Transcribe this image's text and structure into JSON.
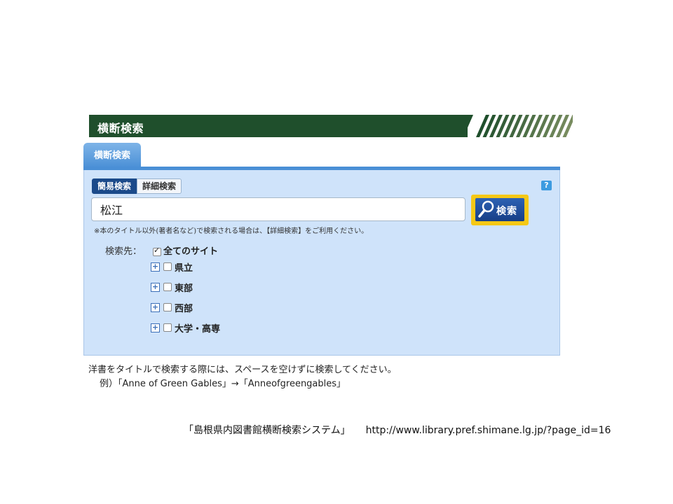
{
  "header": {
    "title": "横断検索"
  },
  "tab": {
    "label": "横断検索"
  },
  "mode_tabs": {
    "simple": "簡易検索",
    "detail": "詳細検索"
  },
  "help": {
    "label": "?"
  },
  "search": {
    "value": "松江",
    "button_label": "検索"
  },
  "note": "※本のタイトル以外(著者名など)で検索される場合は、【詳細検索】をご利用ください。",
  "targets": {
    "label": "検索先：",
    "all_sites": {
      "label": "全てのサイト",
      "checked": true
    },
    "regions": [
      {
        "label": "県立",
        "checked": false
      },
      {
        "label": "東部",
        "checked": false
      },
      {
        "label": "西部",
        "checked": false
      },
      {
        "label": "大学・高専",
        "checked": false
      }
    ]
  },
  "tips": {
    "line1": "洋書をタイトルで検索する際には、スペースを空けずに検索してください。",
    "line2": "例）「Anne of Green Gables」→「Anneofgreengables」"
  },
  "caption": {
    "system_name": "「島根県内図書館横断検索システム」",
    "url": "http://www.library.pref.shimane.lg.jp/?page_id=16"
  },
  "colors": {
    "header": "#1f4f2c",
    "tab": "#4a8fd6",
    "panel": "#cfe3fa",
    "button": "#173e86",
    "button_frame": "#f5c816"
  }
}
